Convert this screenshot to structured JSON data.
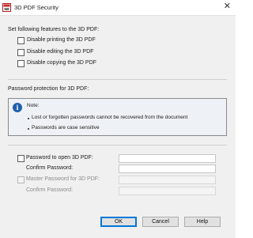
{
  "window": {
    "title": "3D PDF Security",
    "close_glyph": "✕"
  },
  "features": {
    "heading": "Set following features to the 3D PDF:",
    "options": [
      {
        "label": "Disable printing the 3D PDF",
        "checked": false
      },
      {
        "label": "Disable editing the 3D PDF",
        "checked": false
      },
      {
        "label": "Disable copying the 3D PDF",
        "checked": false
      }
    ]
  },
  "password": {
    "heading": "Password protection for 3D PDF:",
    "note": {
      "icon": "info-icon",
      "title": "Note:",
      "bullets": [
        "Lost or forgotten passwords cannot be recovered from the document",
        "Passwords are case sensitive"
      ]
    },
    "open_password": {
      "label": "Password to open 3D PDF:",
      "checked": false,
      "value": "",
      "confirm_label": "Confirm Password:",
      "confirm_value": ""
    },
    "master_password": {
      "label": "Master Password for 3D PDF:",
      "checked": false,
      "value": "",
      "confirm_label": "Confirm Password:",
      "confirm_value": ""
    }
  },
  "buttons": {
    "ok": "OK",
    "cancel": "Cancel",
    "help": "Help"
  },
  "colors": {
    "accent": "#0078d7",
    "info_icon": "#1f5fae",
    "dialog_bg": "#f0f0f0"
  }
}
